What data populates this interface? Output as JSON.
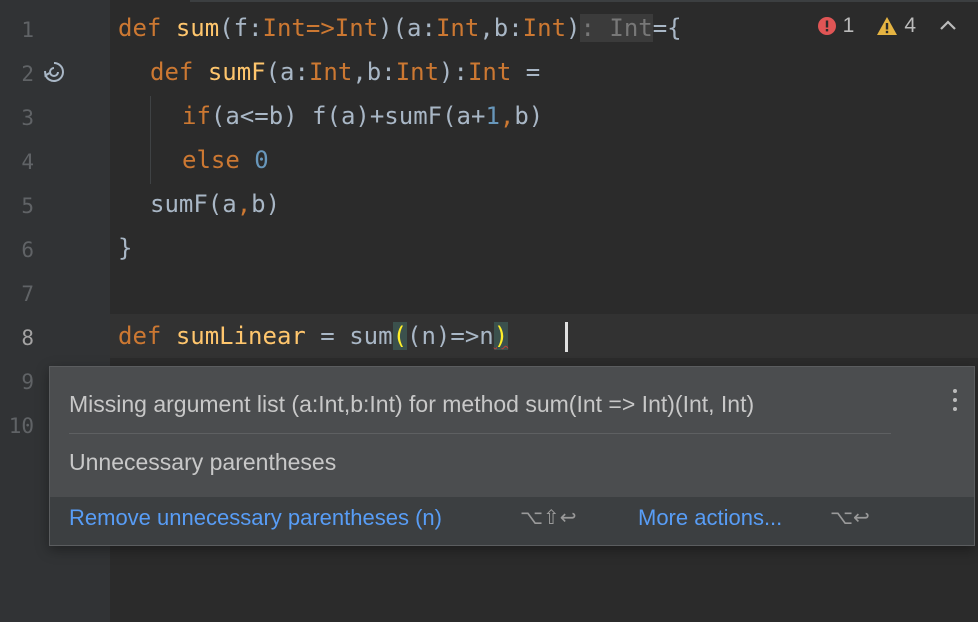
{
  "gutter": {
    "line_numbers": [
      "1",
      "2",
      "3",
      "4",
      "5",
      "6",
      "7",
      "8",
      "9",
      "10"
    ],
    "gutter_icon": "recursion-icon"
  },
  "code": {
    "line1": {
      "kw": "def",
      "fn": "sum",
      "rest1": "(f:",
      "t1": "Int",
      "arrow": "=>",
      "t2": "Int",
      "rest2": ")(a:",
      "t3": "Int",
      "rest3": ",b:",
      "t4": "Int",
      "rest4": ")",
      "hint": ": Int",
      "rest5": "={"
    },
    "line2": {
      "kw": "def",
      "fn": "sumF",
      "rest1": "(a:",
      "t1": "Int",
      "rest2": ",b:",
      "t2": "Int",
      "rest3": "):",
      "t3": "Int",
      "rest4": " ="
    },
    "line3": {
      "kw": "if",
      "rest1": "(a<=b) f(a)+sumF(a+",
      "num": "1",
      "comma": ",",
      "rest2": "b)"
    },
    "line4": {
      "kw": "else",
      "num": "0"
    },
    "line5": {
      "rest1": "sumF(a",
      "comma": ",",
      "rest2": "b)"
    },
    "line6": {
      "brace": "}"
    },
    "line8": {
      "kw": "def",
      "fn": "sumLinear",
      "rest1": " = sum",
      "open_paren": "(",
      "rest2": "(n)=>n",
      "close_paren": ")"
    }
  },
  "inspections": {
    "errors": "1",
    "warnings": "4",
    "error_color": "#e05555",
    "warning_color": "#e5b442"
  },
  "popup": {
    "message1": "Missing argument list (a:Int,b:Int) for method sum(Int => Int)(Int, Int)",
    "message2": "Unnecessary parentheses",
    "action_label": "Remove unnecessary parentheses (n)",
    "action_shortcut": "⌥⇧↩",
    "more_label": "More actions...",
    "more_shortcut": "⌥↩",
    "link_color": "#589df6"
  }
}
